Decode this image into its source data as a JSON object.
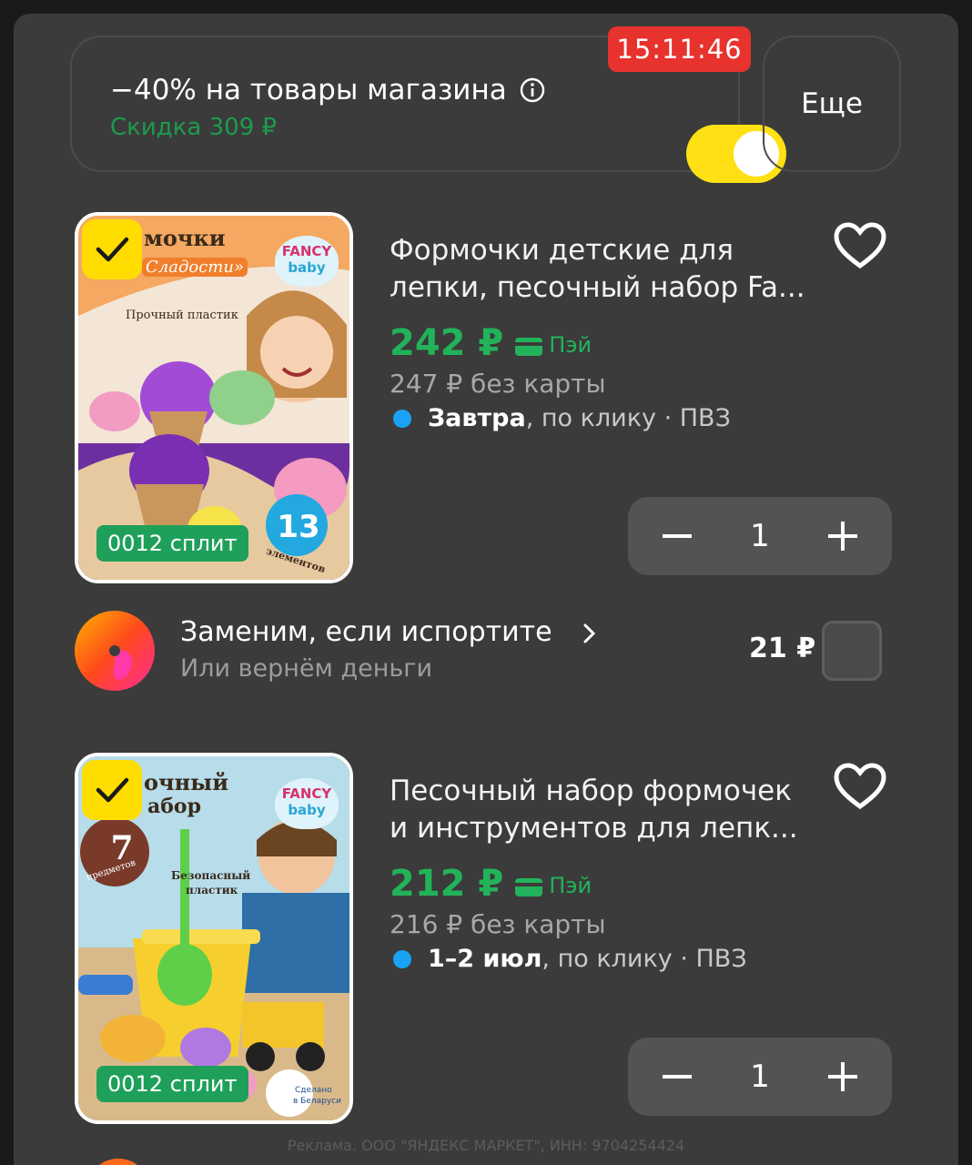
{
  "promo": {
    "title": "−40% на товары магазина",
    "discount": "Скидка 309 ₽",
    "timer": "15:11:46",
    "toggle_on": true,
    "more_label": "Еще"
  },
  "products": [
    {
      "title_line1": "Формочки детские для",
      "title_line2": "лепки, песочный набор Fa...",
      "price": "242 ₽",
      "pay_label": "Пэй",
      "old_price": "247 ₽ без карты",
      "delivery_strong": "Завтра",
      "delivery_rest": ", по клику · ПВЗ",
      "quantity": "1",
      "split_label": "0012 сплит",
      "image_heading": "мочки",
      "image_subheading": "Сладости»",
      "image_note": "Прочный пластик",
      "image_count": "13",
      "image_count_label": "элементов",
      "brand_line1": "FANCY",
      "brand_line2": "baby"
    },
    {
      "title_line1": "Песочный набор формочек",
      "title_line2": "и инструментов для лепк...",
      "price": "212 ₽",
      "pay_label": "Пэй",
      "old_price": "216 ₽ без карты",
      "delivery_strong": "1–2 июл",
      "delivery_rest": ", по клику · ПВЗ",
      "quantity": "1",
      "split_label": "0012 сплит",
      "image_heading": "очный",
      "image_subheading": "абор",
      "image_note_line1": "Безопасный",
      "image_note_line2": "пластик",
      "image_count": "7",
      "image_count_label": "предметов",
      "made_in_line1": "Сделано",
      "made_in_line2": "в Беларуси",
      "brand_line1": "FANCY",
      "brand_line2": "baby"
    }
  ],
  "insurance": {
    "title": "Заменим, если испортите",
    "subtitle": "Или вернём деньги",
    "price": "21 ₽",
    "checked": false
  },
  "ad_note": "Реклама. ООО \"ЯНДЕКС МАРКЕТ\", ИНН: 9704254424",
  "colors": {
    "background": "#3b3b3b",
    "accent_green": "#22b35a",
    "timer_red": "#e8322d",
    "toggle_yellow": "#ffe014",
    "delivery_blue": "#1aa3f5"
  }
}
